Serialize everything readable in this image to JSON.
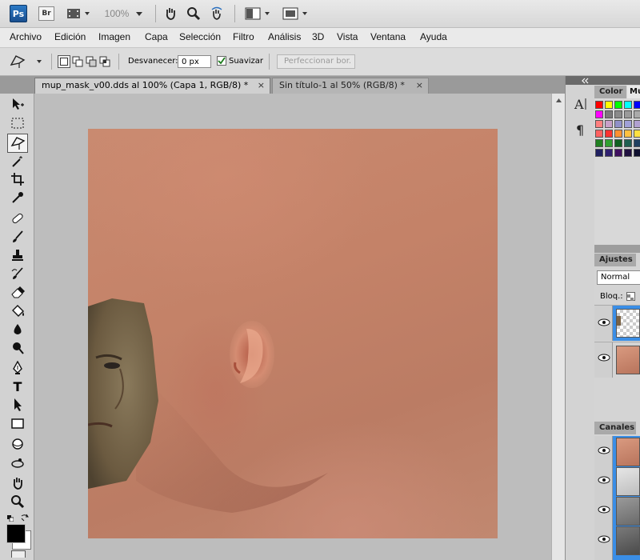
{
  "app": {
    "logo": "Ps",
    "bridge": "Br",
    "zoom": "100%"
  },
  "menu": [
    "Archivo",
    "Edición",
    "Imagen",
    "Capa",
    "Selección",
    "Filtro",
    "Análisis",
    "3D",
    "Vista",
    "Ventana",
    "Ayuda"
  ],
  "options": {
    "feather_label": "Desvanecer:",
    "feather_value": "0 px",
    "antialias_label": "Suavizar",
    "refine_label": "Perfeccionar bor."
  },
  "tabs": [
    {
      "label": "mup_mask_v00.dds al 100% (Capa 1, RGB/8) *",
      "close": "×"
    },
    {
      "label": "Sin título-1 al 50% (RGB/8) *",
      "close": "×"
    }
  ],
  "panels": {
    "color_tab": "Color",
    "swatches_tab": "Mu",
    "adjustments_tab": "Ajustes",
    "blend_mode": "Normal",
    "lock_label": "Bloq.:",
    "channels_tab": "Canales"
  },
  "colors": {
    "app_bg": "#d6d6d6",
    "canvas_bg": "#bdbdbd",
    "skin": "#c48268",
    "selected_blue": "#3a8ee6"
  },
  "swatch_rows": [
    [
      "#ff0000",
      "#ffff00",
      "#00ff00",
      "#00ffff",
      "#0000ff"
    ],
    [
      "#ff00ff",
      "#7a7a7a",
      "#8a8a8a",
      "#9a9a9a",
      "#aaaaaa"
    ],
    [
      "#ff7f7f",
      "#c8a0c8",
      "#9090c8",
      "#a0a0d8",
      "#b0a0d0"
    ],
    [
      "#ff6060",
      "#ff3030",
      "#ff9030",
      "#ffc040",
      "#ffe040"
    ],
    [
      "#208020",
      "#30a030",
      "#106020",
      "#206050",
      "#204060"
    ],
    [
      "#202060",
      "#302070",
      "#401060",
      "#201040",
      "#101030"
    ]
  ]
}
